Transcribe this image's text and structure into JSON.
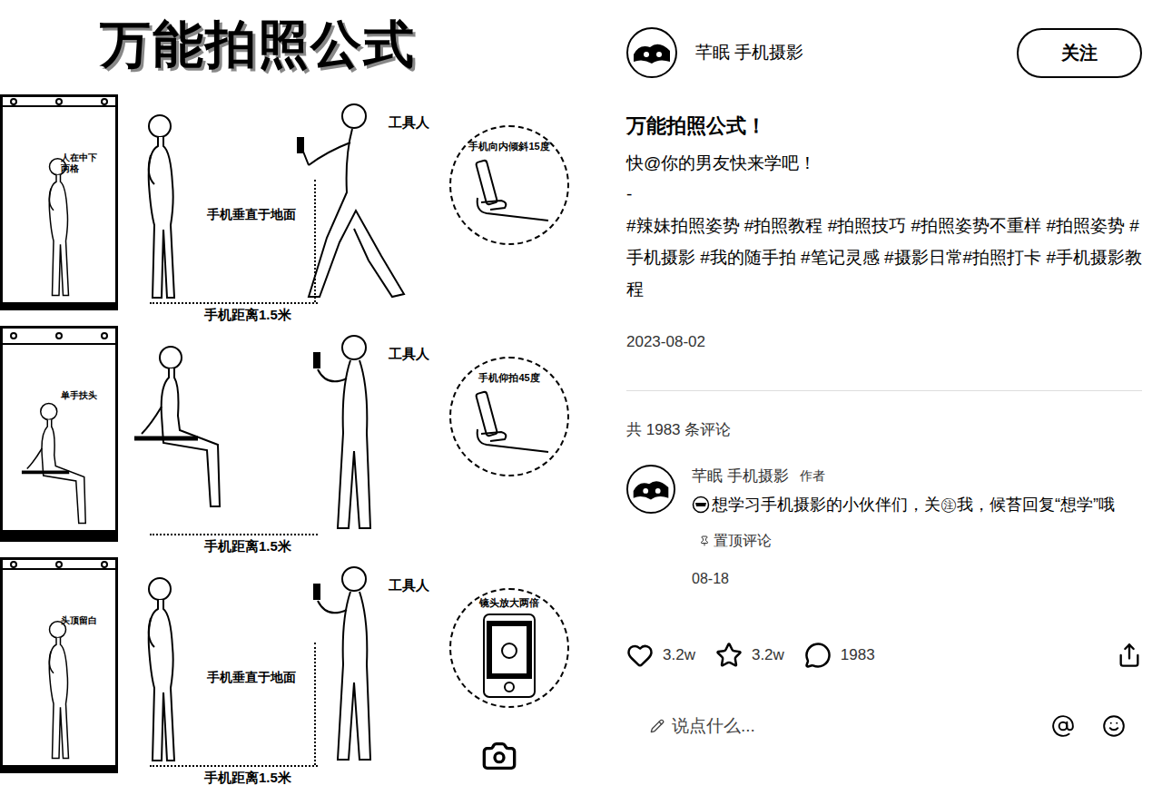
{
  "post_image": {
    "title": "万能拍照公式",
    "rows": [
      {
        "thumb_label": "人在中下两格",
        "photographer": "工具人",
        "distance": "手机距离1.5米",
        "angle_label": "手机垂直于地面",
        "inset_label": "手机向内倾斜15度",
        "kind": "standing",
        "photographer_kind": "lunge",
        "inset_kind": "hand"
      },
      {
        "thumb_label": "单手扶头",
        "photographer": "工具人",
        "distance": "手机距离1.5米",
        "angle_label": "",
        "inset_label": "手机仰拍45度",
        "kind": "sitting",
        "photographer_kind": "standing",
        "inset_kind": "hand"
      },
      {
        "thumb_label": "头顶留白",
        "photographer": "工具人",
        "distance": "手机距离1.5米",
        "angle_label": "手机垂直于地面",
        "inset_label": "镜头放大两倍",
        "kind": "standing",
        "photographer_kind": "standing",
        "inset_kind": "phone"
      }
    ]
  },
  "author": {
    "name": "芊眠 手机摄影"
  },
  "follow_button": "关注",
  "post": {
    "title": "万能拍照公式！",
    "body": [
      "快@你的男友快来学吧！",
      "-"
    ],
    "hashtags": "#辣妹拍照姿势 #拍照教程 #拍照技巧 #拍照姿势不重样 #拍照姿势 #手机摄影 #我的随手拍 #笔记灵感 #摄影日常#拍照打卡 #手机摄影教程",
    "date": "2023-08-02"
  },
  "comments_count": "共 1983 条评论",
  "comments": [
    {
      "author": "芊眠 手机摄影",
      "badge": "作者",
      "text": "想学习手机摄影的小伙伴们，关㊟我，候苔回复“想学”哦",
      "pinned_label": "置顶评论",
      "time": "08-18"
    }
  ],
  "actions": [
    {
      "kind": "like",
      "count": "3.2w"
    },
    {
      "kind": "collect",
      "count": "3.2w"
    },
    {
      "kind": "comment",
      "count": "1983"
    }
  ],
  "input": {
    "placeholder": "说点什么..."
  }
}
